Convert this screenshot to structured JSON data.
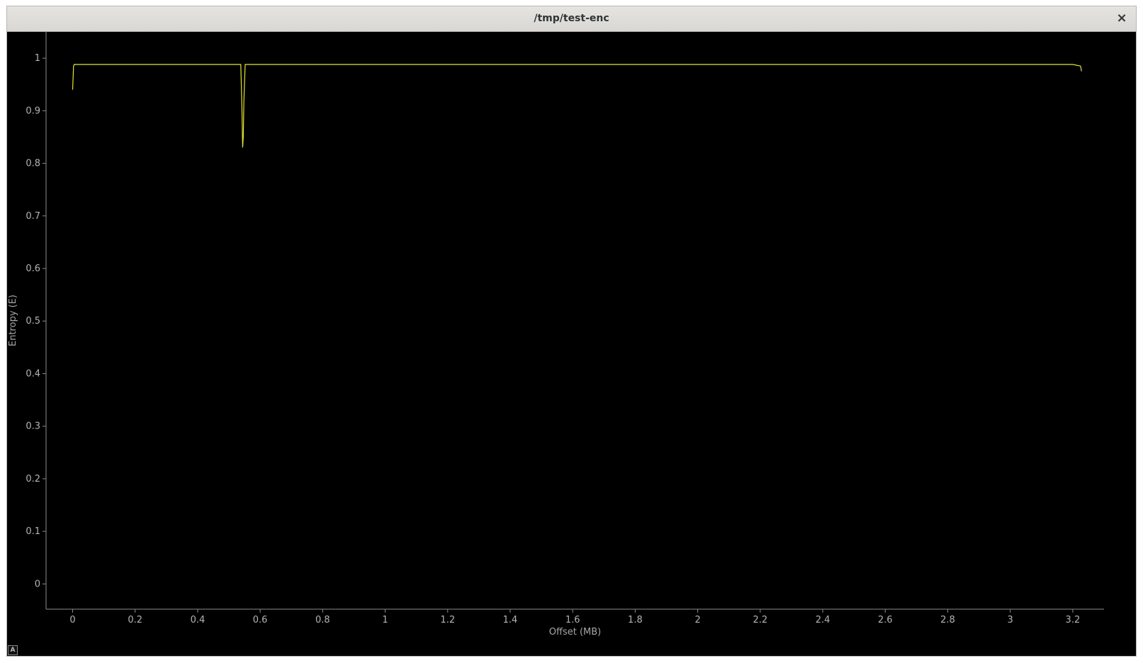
{
  "window": {
    "title": "/tmp/test-enc",
    "close_symbol": "×",
    "autoscale_label": "A"
  },
  "chart_data": {
    "type": "line",
    "title": "",
    "xlabel": "Offset (MB)",
    "ylabel": "Entropy (E)",
    "xlim": [
      -0.085,
      3.3
    ],
    "ylim": [
      -0.048,
      1.05
    ],
    "xticks": [
      0,
      0.2,
      0.4,
      0.6,
      0.8,
      1,
      1.2,
      1.4,
      1.6,
      1.8,
      2,
      2.2,
      2.4,
      2.6,
      2.8,
      3,
      3.2
    ],
    "xtick_labels": [
      "0",
      "0.2",
      "0.4",
      "0.6",
      "0.8",
      "1",
      "1.2",
      "1.4",
      "1.6",
      "1.8",
      "2",
      "2.2",
      "2.4",
      "2.6",
      "2.8",
      "3",
      "3.2"
    ],
    "yticks": [
      0,
      0.1,
      0.2,
      0.3,
      0.4,
      0.5,
      0.6,
      0.7,
      0.8,
      0.9,
      1
    ],
    "ytick_labels": [
      "0",
      "0.1",
      "0.2",
      "0.3",
      "0.4",
      "0.5",
      "0.6",
      "0.7",
      "0.8",
      "0.9",
      "1"
    ],
    "grid": false,
    "background": "#000000",
    "axis_color": "#8c8c8c",
    "line_color": "#e6e62e",
    "series": [
      {
        "x": [
          0,
          0.003,
          0.005,
          0.1,
          0.3,
          0.5,
          0.538,
          0.542,
          0.544,
          0.546,
          0.548,
          0.552,
          0.6,
          1.0,
          1.5,
          2.0,
          2.5,
          3.0,
          3.2,
          3.225,
          3.228
        ],
        "values": [
          0.94,
          0.985,
          0.988,
          0.988,
          0.988,
          0.988,
          0.988,
          0.9,
          0.83,
          0.85,
          0.92,
          0.988,
          0.988,
          0.988,
          0.988,
          0.988,
          0.988,
          0.988,
          0.988,
          0.985,
          0.975
        ]
      }
    ]
  }
}
